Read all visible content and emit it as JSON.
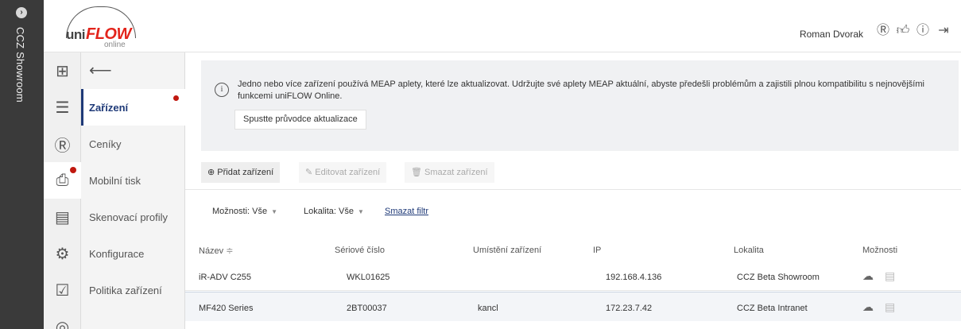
{
  "tenant": {
    "name": "CCZ Showroom",
    "toggle_icon": "chevron-circle-icon"
  },
  "header": {
    "logo": {
      "uni": "uni",
      "flow": "FLOW",
      "online": "online"
    },
    "user_name": "Roman Dvorak",
    "icons": [
      "user-circle-icon",
      "thumbs-up-icon",
      "help-circle-icon",
      "logout-icon"
    ]
  },
  "rail": {
    "items": [
      {
        "icon": "dashboard-icon",
        "glyph": "⊞"
      },
      {
        "icon": "stack-icon",
        "glyph": "☰"
      },
      {
        "icon": "user-circle-icon",
        "glyph": "Ⓡ"
      },
      {
        "icon": "printer-icon",
        "glyph": "⎙",
        "active": true,
        "badge": true
      },
      {
        "icon": "document-icon",
        "glyph": "▤"
      },
      {
        "icon": "settings-icon",
        "glyph": "⚙"
      },
      {
        "icon": "checklist-icon",
        "glyph": "☑"
      },
      {
        "icon": "more-icon",
        "glyph": "◎"
      }
    ]
  },
  "subnav": {
    "back_icon": "back-arrow-icon",
    "items": [
      {
        "label": "Zařízení",
        "active": true,
        "badge": true
      },
      {
        "label": "Ceníky"
      },
      {
        "label": "Mobilní tisk"
      },
      {
        "label": "Skenovací profily"
      },
      {
        "label": "Konfigurace"
      },
      {
        "label": "Politika zařízení"
      }
    ]
  },
  "banner": {
    "message": "Jedno nebo více zařízení používá MEAP aplety, které lze aktualizovat. Udržujte své aplety MEAP aktuální, abyste předešli problémům a zajistili plnou kompatibilitu s nejnovějšími funkcemi uniFLOW Online.",
    "button_label": "Spustte průvodce aktualizace"
  },
  "toolbar": {
    "add": "Přidat zařízení",
    "edit": "Editovat zařízení",
    "delete": "Smazat zařízení"
  },
  "filters": {
    "options": "Možnosti: Vše",
    "location": "Lokalita: Vše",
    "clear": "Smazat filtr"
  },
  "table": {
    "columns": [
      "Název",
      "Sériové číslo",
      "Umístění zařízení",
      "IP",
      "Lokalita",
      "Možnosti"
    ],
    "sort_indicator": "≑",
    "rows": [
      {
        "name": "iR-ADV C255",
        "serial": "WKL01625",
        "placement": "",
        "ip": "192.168.4.136",
        "location": "CCZ Beta Showroom"
      },
      {
        "name": "MF420 Series",
        "serial": "2BT00037",
        "placement": "kancl",
        "ip": "172.23.7.42",
        "location": "CCZ Beta Intranet"
      }
    ]
  },
  "colors": {
    "accent": "#1f3a78",
    "badge": "#c0180f",
    "brand_red": "#e3241b",
    "tenant_bg": "#3a3a3a"
  }
}
